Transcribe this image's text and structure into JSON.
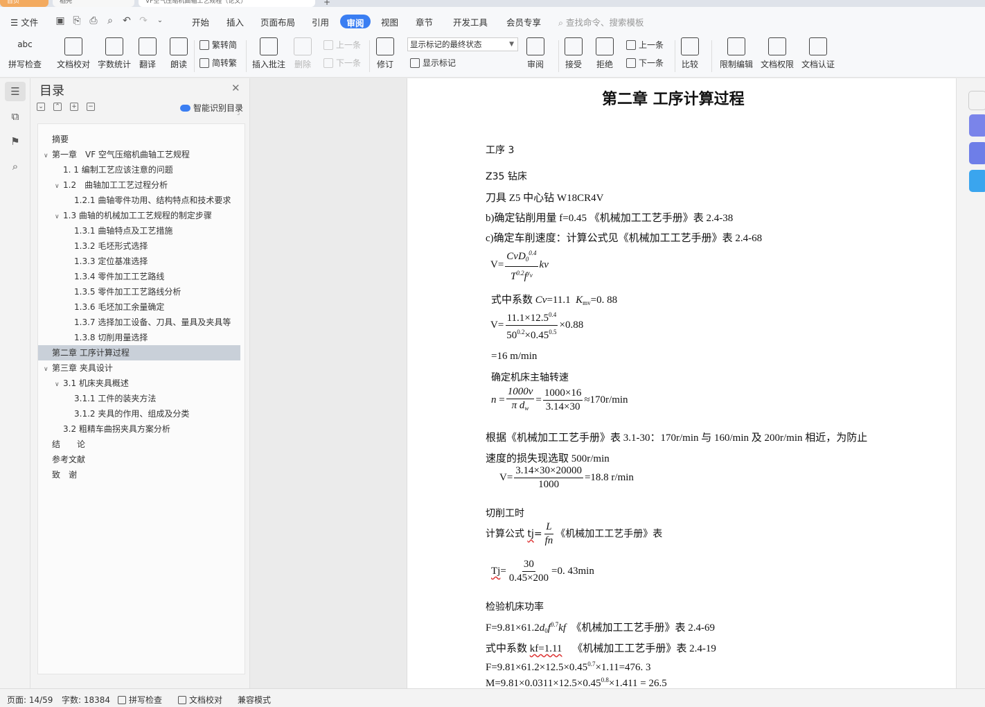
{
  "window": {
    "tabs": [
      "首页",
      "稻壳",
      "VF空气压缩机曲轴工艺规程（论文）"
    ]
  },
  "menubar": {
    "file": "文件",
    "items": [
      "开始",
      "插入",
      "页面布局",
      "引用",
      "审阅",
      "视图",
      "章节",
      "开发工具",
      "会员专享"
    ],
    "active": "审阅",
    "search_placeholder": "查找命令、搜索模板"
  },
  "ribbon": {
    "spell": "拼写检查",
    "doc_check": "文档校对",
    "word_count": "字数统计",
    "translate": "翻译",
    "read": "朗读",
    "trad": "繁转简",
    "simp": "简转繁",
    "insert_comment": "插入批注",
    "delete": "删除",
    "prev_comment": "上一条",
    "next_comment": "下一条",
    "track": "修订",
    "markup_state": "显示标记的最终状态",
    "show_markup": "显示标记",
    "review_pane": "审阅",
    "accept": "接受",
    "reject": "拒绝",
    "prev_change": "上一条",
    "next_change": "下一条",
    "compare": "比较",
    "restrict": "限制编辑",
    "doc_perm": "文档权限",
    "doc_auth": "文档认证"
  },
  "toc": {
    "title": "目录",
    "smart": "智能识别目录",
    "items": [
      {
        "label": "摘要",
        "level": 0,
        "chev": ""
      },
      {
        "label": "第一章　VF 空气压缩机曲轴工艺规程",
        "level": 0,
        "chev": "v"
      },
      {
        "label": "1. 1  编制工艺应该注意的问题",
        "level": 1,
        "chev": ""
      },
      {
        "label": "1.2　曲轴加工工艺过程分析",
        "level": 1,
        "chev": "v"
      },
      {
        "label": "1.2.1  曲轴零件功用、结构特点和技术要求",
        "level": 2,
        "chev": ""
      },
      {
        "label": "1.3  曲轴的机械加工工艺规程的制定步骤",
        "level": 1,
        "chev": "v"
      },
      {
        "label": "1.3.1 曲轴特点及工艺措施",
        "level": 2,
        "chev": ""
      },
      {
        "label": "1.3.2  毛坯形式选择",
        "level": 2,
        "chev": ""
      },
      {
        "label": "1.3.3  定位基准选择",
        "level": 2,
        "chev": ""
      },
      {
        "label": "1.3.4  零件加工工艺路线",
        "level": 2,
        "chev": ""
      },
      {
        "label": "1.3.5  零件加工工艺路线分析",
        "level": 2,
        "chev": ""
      },
      {
        "label": "1.3.6  毛坯加工余量确定",
        "level": 2,
        "chev": ""
      },
      {
        "label": "1.3.7  选择加工设备、刀具、量具及夹具等",
        "level": 2,
        "chev": ""
      },
      {
        "label": "1.3.8  切削用量选择",
        "level": 2,
        "chev": ""
      },
      {
        "label": "第二章  工序计算过程",
        "level": 0,
        "chev": "",
        "selected": true
      },
      {
        "label": "第三章  夹具设计",
        "level": 0,
        "chev": "v"
      },
      {
        "label": "3.1  机床夹具概述",
        "level": 1,
        "chev": "v"
      },
      {
        "label": "3.1.1  工件的装夹方法",
        "level": 2,
        "chev": ""
      },
      {
        "label": "3.1.2  夹具的作用、组成及分类",
        "level": 2,
        "chev": ""
      },
      {
        "label": "3.2  粗精车曲拐夹具方案分析",
        "level": 1,
        "chev": ""
      },
      {
        "label": "结　　论",
        "level": 0,
        "chev": ""
      },
      {
        "label": "参考文献",
        "level": 0,
        "chev": ""
      },
      {
        "label": "致　谢",
        "level": 0,
        "chev": ""
      }
    ]
  },
  "doc": {
    "chapter_title": "第二章  工序计算过程",
    "step": "工序 3",
    "machine": "Z35 钻床",
    "tool": "刀具 Z5 中心钻  W18CR4V",
    "line_b": "b)确定钻削用量  f=0.45  《机械加工工艺手册》表 2.4-38",
    "line_c": "c)确定车削速度：计算公式见《机械加工工艺手册》表 2.4-68",
    "coef": "式中系数",
    "coef_cv": "=11.1",
    "coef_kmv": "=0. 88",
    "v_eq_num": "11.1×12.5",
    "v_eq_den": "50",
    "v_eq_tail": "×0.88",
    "v_result": "=16  m/min",
    "spindle": "确定机床主轴转速",
    "n_num1": "1000v",
    "n_num2": "1000×16",
    "n_den2": "3.14×30",
    "n_result": "≈170r/min",
    "para1": "根据《机械加工工艺手册》表 3.1-30：170r/min 与 160/min 及 200r/min 相近，为防止",
    "para2": "速度的损失现选取 500r/min",
    "v2_num": "3.14×30×20000",
    "v2_den": "1000",
    "v2_result": "=18.8  r/min",
    "cut_time": "切削工时",
    "formula_label": "计算公式",
    "formula_ref": "《机械加工工艺手册》表",
    "tj_num": "30",
    "tj_den": "0.45×200",
    "tj_result": "=0. 43min",
    "power": "检验机床功率",
    "f_line_ref": "《机械加工工艺手册》表 2.4-69",
    "kf_line": "式中系数",
    "kf_value": "kf=1.11",
    "kf_ref": "《机械加工工艺手册》表 2.4-19",
    "f_calc": "F=9.81×61.2×12.5×0.45",
    "f_calc_tail": "×1.11=476. 3",
    "m_calc": "M=9.81×0.0311×12.5×0.45",
    "m_calc_tail": "×1.411 = 26.5"
  },
  "status": {
    "page": "页面: 14/59",
    "words": "字数: 18384",
    "spell": "拼写检查",
    "proof": "文档校对",
    "compat": "兼容模式"
  }
}
